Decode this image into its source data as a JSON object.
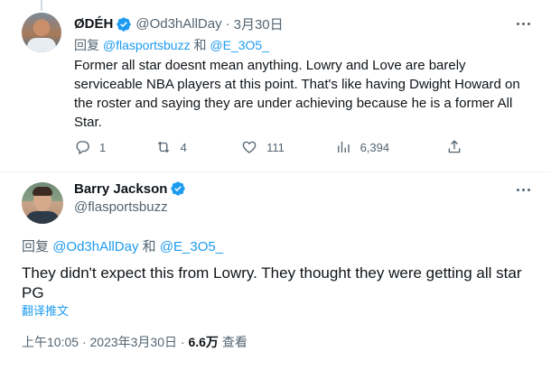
{
  "reply_tweet": {
    "author_name": "ØDÉH",
    "handle": "@Od3hAllDay",
    "separator": "·",
    "date": "3月30日",
    "replying_prefix": "回复",
    "replying_to_1": "@flasportsbuzz",
    "replying_and": "和",
    "replying_to_2": "@E_3O5_",
    "text": "Former all star doesnt mean anything. Lowry and Love are barely serviceable NBA players at this point. That's like having Dwight Howard on the roster and saying they are under achieving because he is a former All Star.",
    "stats": {
      "replies": "1",
      "retweets": "4",
      "likes": "111",
      "views": "6,394"
    }
  },
  "main_tweet": {
    "author_name": "Barry Jackson",
    "handle": "@flasportsbuzz",
    "replying_prefix": "回复",
    "replying_to_1": "@Od3hAllDay",
    "replying_and": "和",
    "replying_to_2": "@E_3O5_",
    "text": "They didn't expect this from Lowry. They thought they were getting all star PG",
    "translate_label": "翻译推文",
    "time": "上午10:05",
    "separator": "·",
    "date": "2023年3月30日",
    "views_count": "6.6万",
    "views_label": "查看"
  },
  "colors": {
    "accent": "#1d9bf0",
    "muted": "#536471",
    "text": "#0f1419"
  },
  "icons": [
    "verified-badge-icon",
    "more-icon",
    "reply-icon",
    "retweet-icon",
    "like-icon",
    "views-icon",
    "share-icon"
  ]
}
